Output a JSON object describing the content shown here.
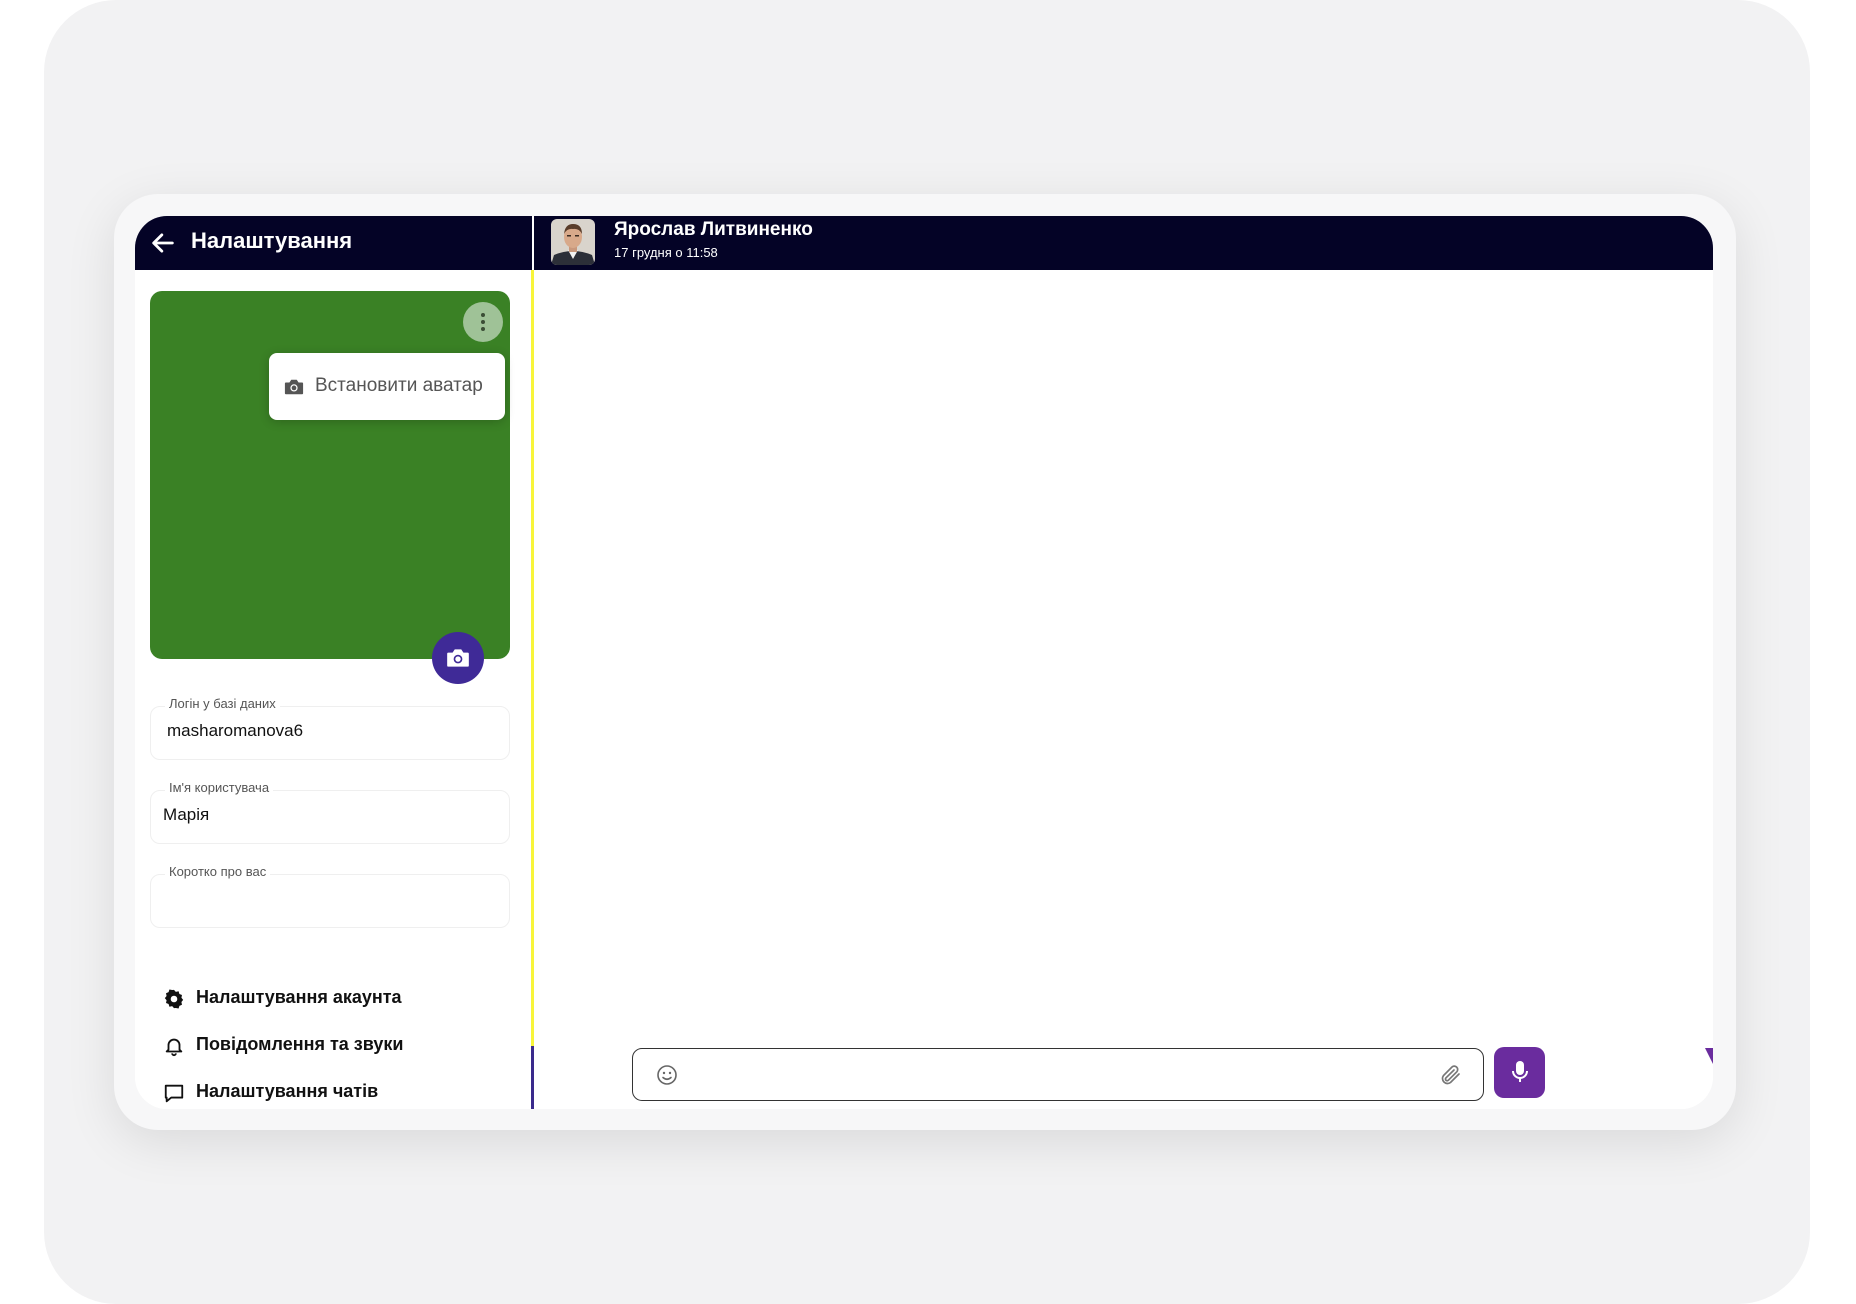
{
  "sidebar": {
    "title": "Налаштування",
    "set_avatar_label": "Встановити аватар",
    "avatar_bg_color": "#3a8125",
    "fields": {
      "login": {
        "label": "Логін у базі даних",
        "value": "masharomanova6"
      },
      "username": {
        "label": "Ім'я користувача",
        "value": "Марія"
      },
      "about": {
        "label": "Коротко про вас",
        "value": ""
      }
    },
    "menu": [
      {
        "label": "Налаштування акаунта",
        "icon": "gear-icon"
      },
      {
        "label": "Повідомлення та звуки",
        "icon": "bell-icon"
      },
      {
        "label": "Налаштування чатів",
        "icon": "chat-bubble-icon"
      }
    ]
  },
  "chat": {
    "contact_name": "Ярослав Литвиненко",
    "contact_status": "17 грудня о 11:58",
    "message_placeholder": ""
  },
  "colors": {
    "header_bg": "#040326",
    "accent_purple": "#6a2c9e",
    "camera_fab": "#3f2a97",
    "divider_yellow": "#f8f53a"
  }
}
